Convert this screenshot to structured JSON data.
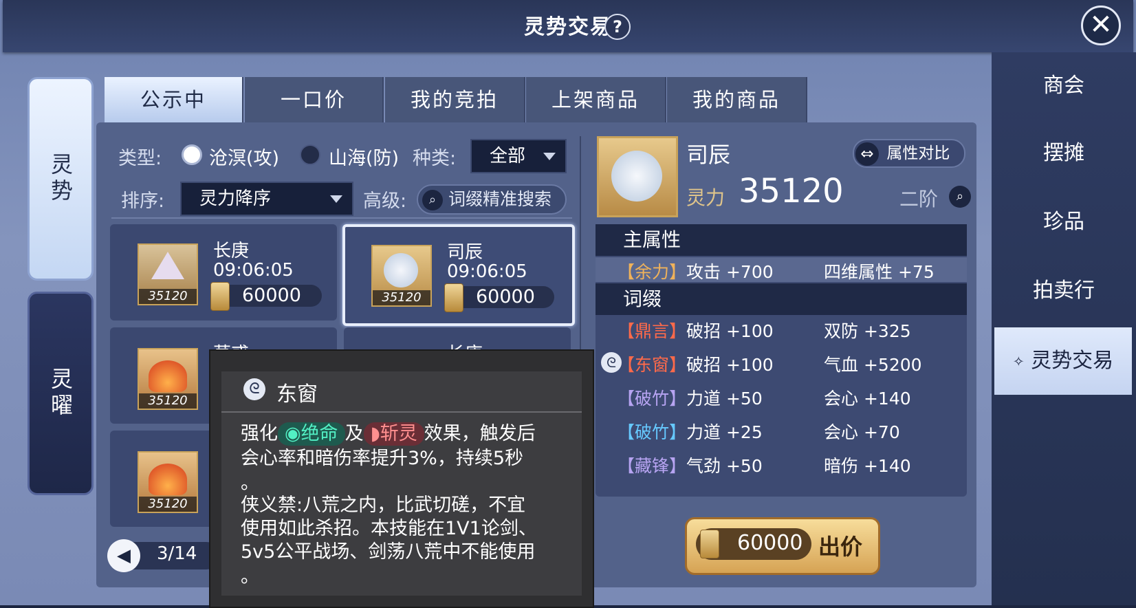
{
  "window": {
    "title": "灵势交易",
    "help_label": "?",
    "close_label": "✕"
  },
  "right_nav": [
    {
      "label": "商会"
    },
    {
      "label": "摆摊"
    },
    {
      "label": "珍品"
    },
    {
      "label": "拍卖行"
    },
    {
      "label": "灵势交易",
      "active": true
    }
  ],
  "left_tabs": [
    {
      "label": "灵势",
      "active": true
    },
    {
      "label": "灵曜",
      "active": false
    }
  ],
  "tabs": [
    {
      "label": "公示中",
      "active": true
    },
    {
      "label": "一口价"
    },
    {
      "label": "我的竞拍"
    },
    {
      "label": "上架商品"
    },
    {
      "label": "我的商品"
    }
  ],
  "filters": {
    "type_label": "类型:",
    "type_opt1": "沧溟(攻)",
    "type_opt2": "山海(防)",
    "kind_label": "种类:",
    "kind_value": "全部",
    "sort_label": "排序:",
    "sort_value": "灵力降序",
    "adv_label": "高级:",
    "search_label": "词缀精准搜索"
  },
  "listings": [
    {
      "name": "长庚",
      "time": "09:06:05",
      "power": "35120",
      "price": "60000"
    },
    {
      "name": "司辰",
      "time": "09:06:05",
      "power": "35120",
      "price": "60000",
      "selected": true
    },
    {
      "name": "莫惑",
      "power": "35120"
    },
    {
      "name": "长庚"
    },
    {
      "power": "35120"
    }
  ],
  "pager": {
    "text": "3/14"
  },
  "detail": {
    "name": "司辰",
    "power_label": "灵力",
    "power_value": "35120",
    "tier": "二阶",
    "compare_label": "属性对比",
    "main_header": "主属性",
    "main_attrs": [
      {
        "tag": "【余力】",
        "name": "攻击",
        "value": "+700",
        "name2": "四维属性",
        "value2": "+75",
        "tag_color": "#f0b25a"
      }
    ],
    "affix_header": "词缀",
    "affixes": [
      {
        "tag": "【鼎言】",
        "name": "破招",
        "value": "+100",
        "name2": "双防",
        "value2": "+325"
      },
      {
        "tag": "【东窗】",
        "name": "破招",
        "value": "+100",
        "name2": "气血",
        "value2": "+5200"
      },
      {
        "tag": "【破竹】",
        "name": "力道",
        "value": "+50",
        "name2": "会心",
        "value2": "+140"
      },
      {
        "tag": "【破竹】",
        "name": "力道",
        "value": "+25",
        "name2": "会心",
        "value2": "+70"
      },
      {
        "tag": "【藏锋】",
        "name": "气劲",
        "value": "+50",
        "name2": "暗伤",
        "value2": "+140"
      }
    ]
  },
  "tooltip": {
    "title": "东窗",
    "l1a": "强化",
    "pill1": "绝命",
    "l1b": "及",
    "pill2": "斩灵",
    "l1c": "效果，触发后",
    "l2": "会心率和暗伤率提升3%，持续5秒",
    "l3": "。",
    "l4": "侠义禁:八荒之内，比武切磋，不宜",
    "l5": "使用如此杀招。本技能在1V1论剑、",
    "l6": "5v5公平战场、剑荡八荒中不能使用",
    "l7": "。"
  },
  "bid": {
    "price": "60000",
    "label": "出价"
  }
}
